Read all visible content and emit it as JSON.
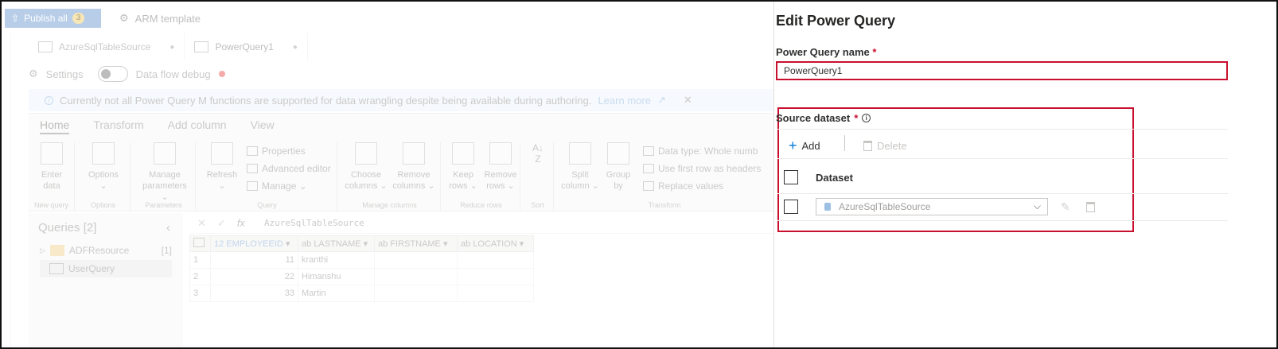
{
  "topbar": {
    "publish_label": "Publish all",
    "publish_count": "3",
    "arm_label": "ARM template"
  },
  "file_tabs": [
    {
      "label": "AzureSqlTableSource",
      "modified": "●"
    },
    {
      "label": "PowerQuery1",
      "modified": "●"
    }
  ],
  "settings": {
    "settings_label": "Settings",
    "debug_label": "Data flow debug",
    "debug_on": false
  },
  "infobar": {
    "message": "Currently not all Power Query M functions are supported for data wrangling despite being available during authoring.",
    "link": "Learn more"
  },
  "ribbon": {
    "tabs": [
      "Home",
      "Transform",
      "Add column",
      "View"
    ],
    "active_tab": "Home",
    "buttons": {
      "enter_data": [
        "Enter",
        "data"
      ],
      "options": [
        "Options",
        "⌄"
      ],
      "manage_parameters": [
        "Manage",
        "parameters ⌄"
      ],
      "refresh": [
        "Refresh",
        "⌄"
      ],
      "choose_columns": [
        "Choose",
        "columns ⌄"
      ],
      "remove_columns": [
        "Remove",
        "columns ⌄"
      ],
      "keep_rows": [
        "Keep",
        "rows ⌄"
      ],
      "remove_rows": [
        "Remove",
        "rows ⌄"
      ],
      "split_column": [
        "Split",
        "column ⌄"
      ],
      "group_by": [
        "Group",
        "by"
      ]
    },
    "small_buttons": {
      "properties": "Properties",
      "advanced_editor": "Advanced editor",
      "manage": "Manage ⌄",
      "data_type": "Data type: Whole numb",
      "first_row_headers": "Use first row as headers",
      "replace_values": "Replace values"
    },
    "groups": {
      "new_query": "New query",
      "options": "Options",
      "parameters": "Parameters",
      "query": "Query",
      "manage_columns": "Manage columns",
      "reduce_rows": "Reduce rows",
      "sort": "Sort",
      "transform": "Transform"
    }
  },
  "queries": {
    "title": "Queries [2]",
    "items": [
      {
        "label": "ADFResource",
        "count": "[1]",
        "type": "folder"
      },
      {
        "label": "UserQuery",
        "count": "",
        "type": "table"
      }
    ]
  },
  "formula": "AzureSqlTableSource",
  "grid": {
    "columns": [
      {
        "type": "12",
        "name": "EMPLOYEEID"
      },
      {
        "type": "ab",
        "name": "LASTNAME"
      },
      {
        "type": "ab",
        "name": "FIRSTNAME"
      },
      {
        "type": "ab",
        "name": "LOCATION"
      }
    ],
    "rows": [
      {
        "n": "1",
        "id": "11",
        "last": "kranthi"
      },
      {
        "n": "2",
        "id": "22",
        "last": "Himanshu"
      },
      {
        "n": "3",
        "id": "33",
        "last": "Martin"
      }
    ]
  },
  "panel": {
    "title": "Edit Power Query",
    "name_label": "Power Query name",
    "required_mark": "*",
    "name_value": "PowerQuery1",
    "source_label": "Source dataset",
    "add_label": "Add",
    "delete_label": "Delete",
    "dataset_header": "Dataset",
    "dataset_value": "AzureSqlTableSource"
  },
  "colors": {
    "accent": "#0078d4",
    "required": "#c8102e",
    "publish_bg": "#7fa4d6"
  }
}
